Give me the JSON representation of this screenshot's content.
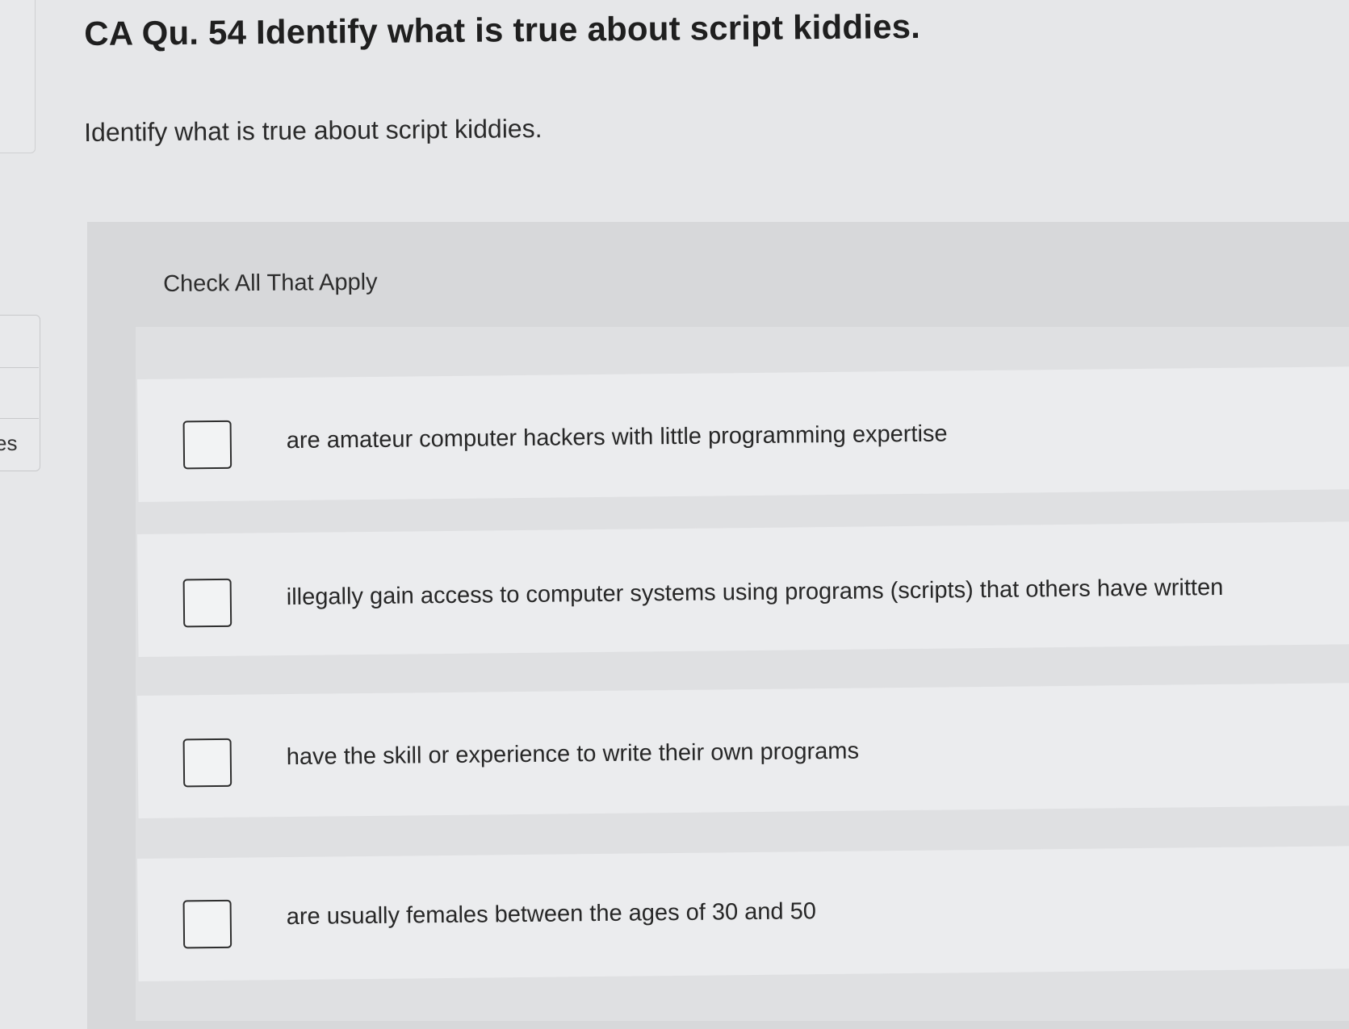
{
  "sidebar": {
    "partial_label": "es"
  },
  "question": {
    "title": "CA Qu. 54 Identify what is true about script kiddies.",
    "prompt": "Identify what is true about script kiddies.",
    "instruction": "Check All That Apply"
  },
  "options": [
    {
      "label": "are amateur computer hackers with little programming expertise",
      "checked": false
    },
    {
      "label": "illegally gain access to computer systems using programs (scripts) that others have written",
      "checked": false
    },
    {
      "label": "have the skill or experience to write their own programs",
      "checked": false
    },
    {
      "label": "are usually females between the ages of 30 and 50",
      "checked": false
    }
  ],
  "colors": {
    "page_background": "#e6e7e9",
    "panel_background": "#d7d8da",
    "option_background": "#ebecee",
    "text": "#262626",
    "checkbox_border": "#2e2e2e"
  }
}
